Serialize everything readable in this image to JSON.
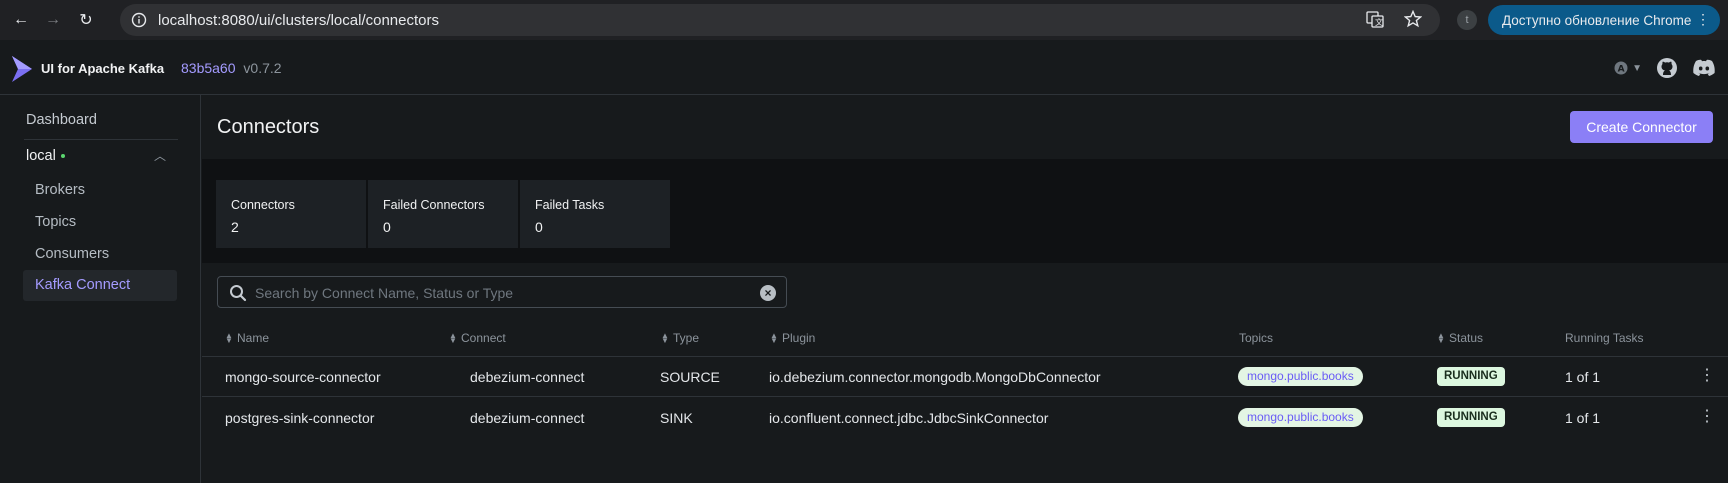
{
  "browser": {
    "url": "localhost:8080/ui/clusters/local/connectors",
    "profile_initial": "t",
    "update_label": "Доступно обновление Chrome"
  },
  "header": {
    "app_title": "UI for Apache Kafka",
    "version_hash": "83b5a60",
    "version": "v0.7.2"
  },
  "sidebar": {
    "dashboard": "Dashboard",
    "cluster": "local",
    "items": [
      {
        "label": "Brokers"
      },
      {
        "label": "Topics"
      },
      {
        "label": "Consumers"
      },
      {
        "label": "Kafka Connect"
      }
    ]
  },
  "page": {
    "title": "Connectors",
    "create_button": "Create Connector"
  },
  "metrics": [
    {
      "label": "Connectors",
      "value": "2"
    },
    {
      "label": "Failed Connectors",
      "value": "0"
    },
    {
      "label": "Failed Tasks",
      "value": "0"
    }
  ],
  "search": {
    "placeholder": "Search by Connect Name, Status or Type"
  },
  "table": {
    "headers": {
      "name": "Name",
      "connect": "Connect",
      "type": "Type",
      "plugin": "Plugin",
      "topics": "Topics",
      "status": "Status",
      "running_tasks": "Running Tasks"
    },
    "rows": [
      {
        "name": "mongo-source-connector",
        "connect": "debezium-connect",
        "type": "SOURCE",
        "plugin": "io.debezium.connector.mongodb.MongoDbConnector",
        "topic": "mongo.public.books",
        "status": "RUNNING",
        "running_tasks": "1 of 1"
      },
      {
        "name": "postgres-sink-connector",
        "connect": "debezium-connect",
        "type": "SINK",
        "plugin": "io.confluent.connect.jdbc.JdbcSinkConnector",
        "topic": "mongo.public.books",
        "status": "RUNNING",
        "running_tasks": "1 of 1"
      }
    ]
  },
  "colors": {
    "accent": "#8b7ff6",
    "active_link": "#a49bff",
    "status_bg": "#dcf7df",
    "tag_bg": "#e3f5e4"
  }
}
